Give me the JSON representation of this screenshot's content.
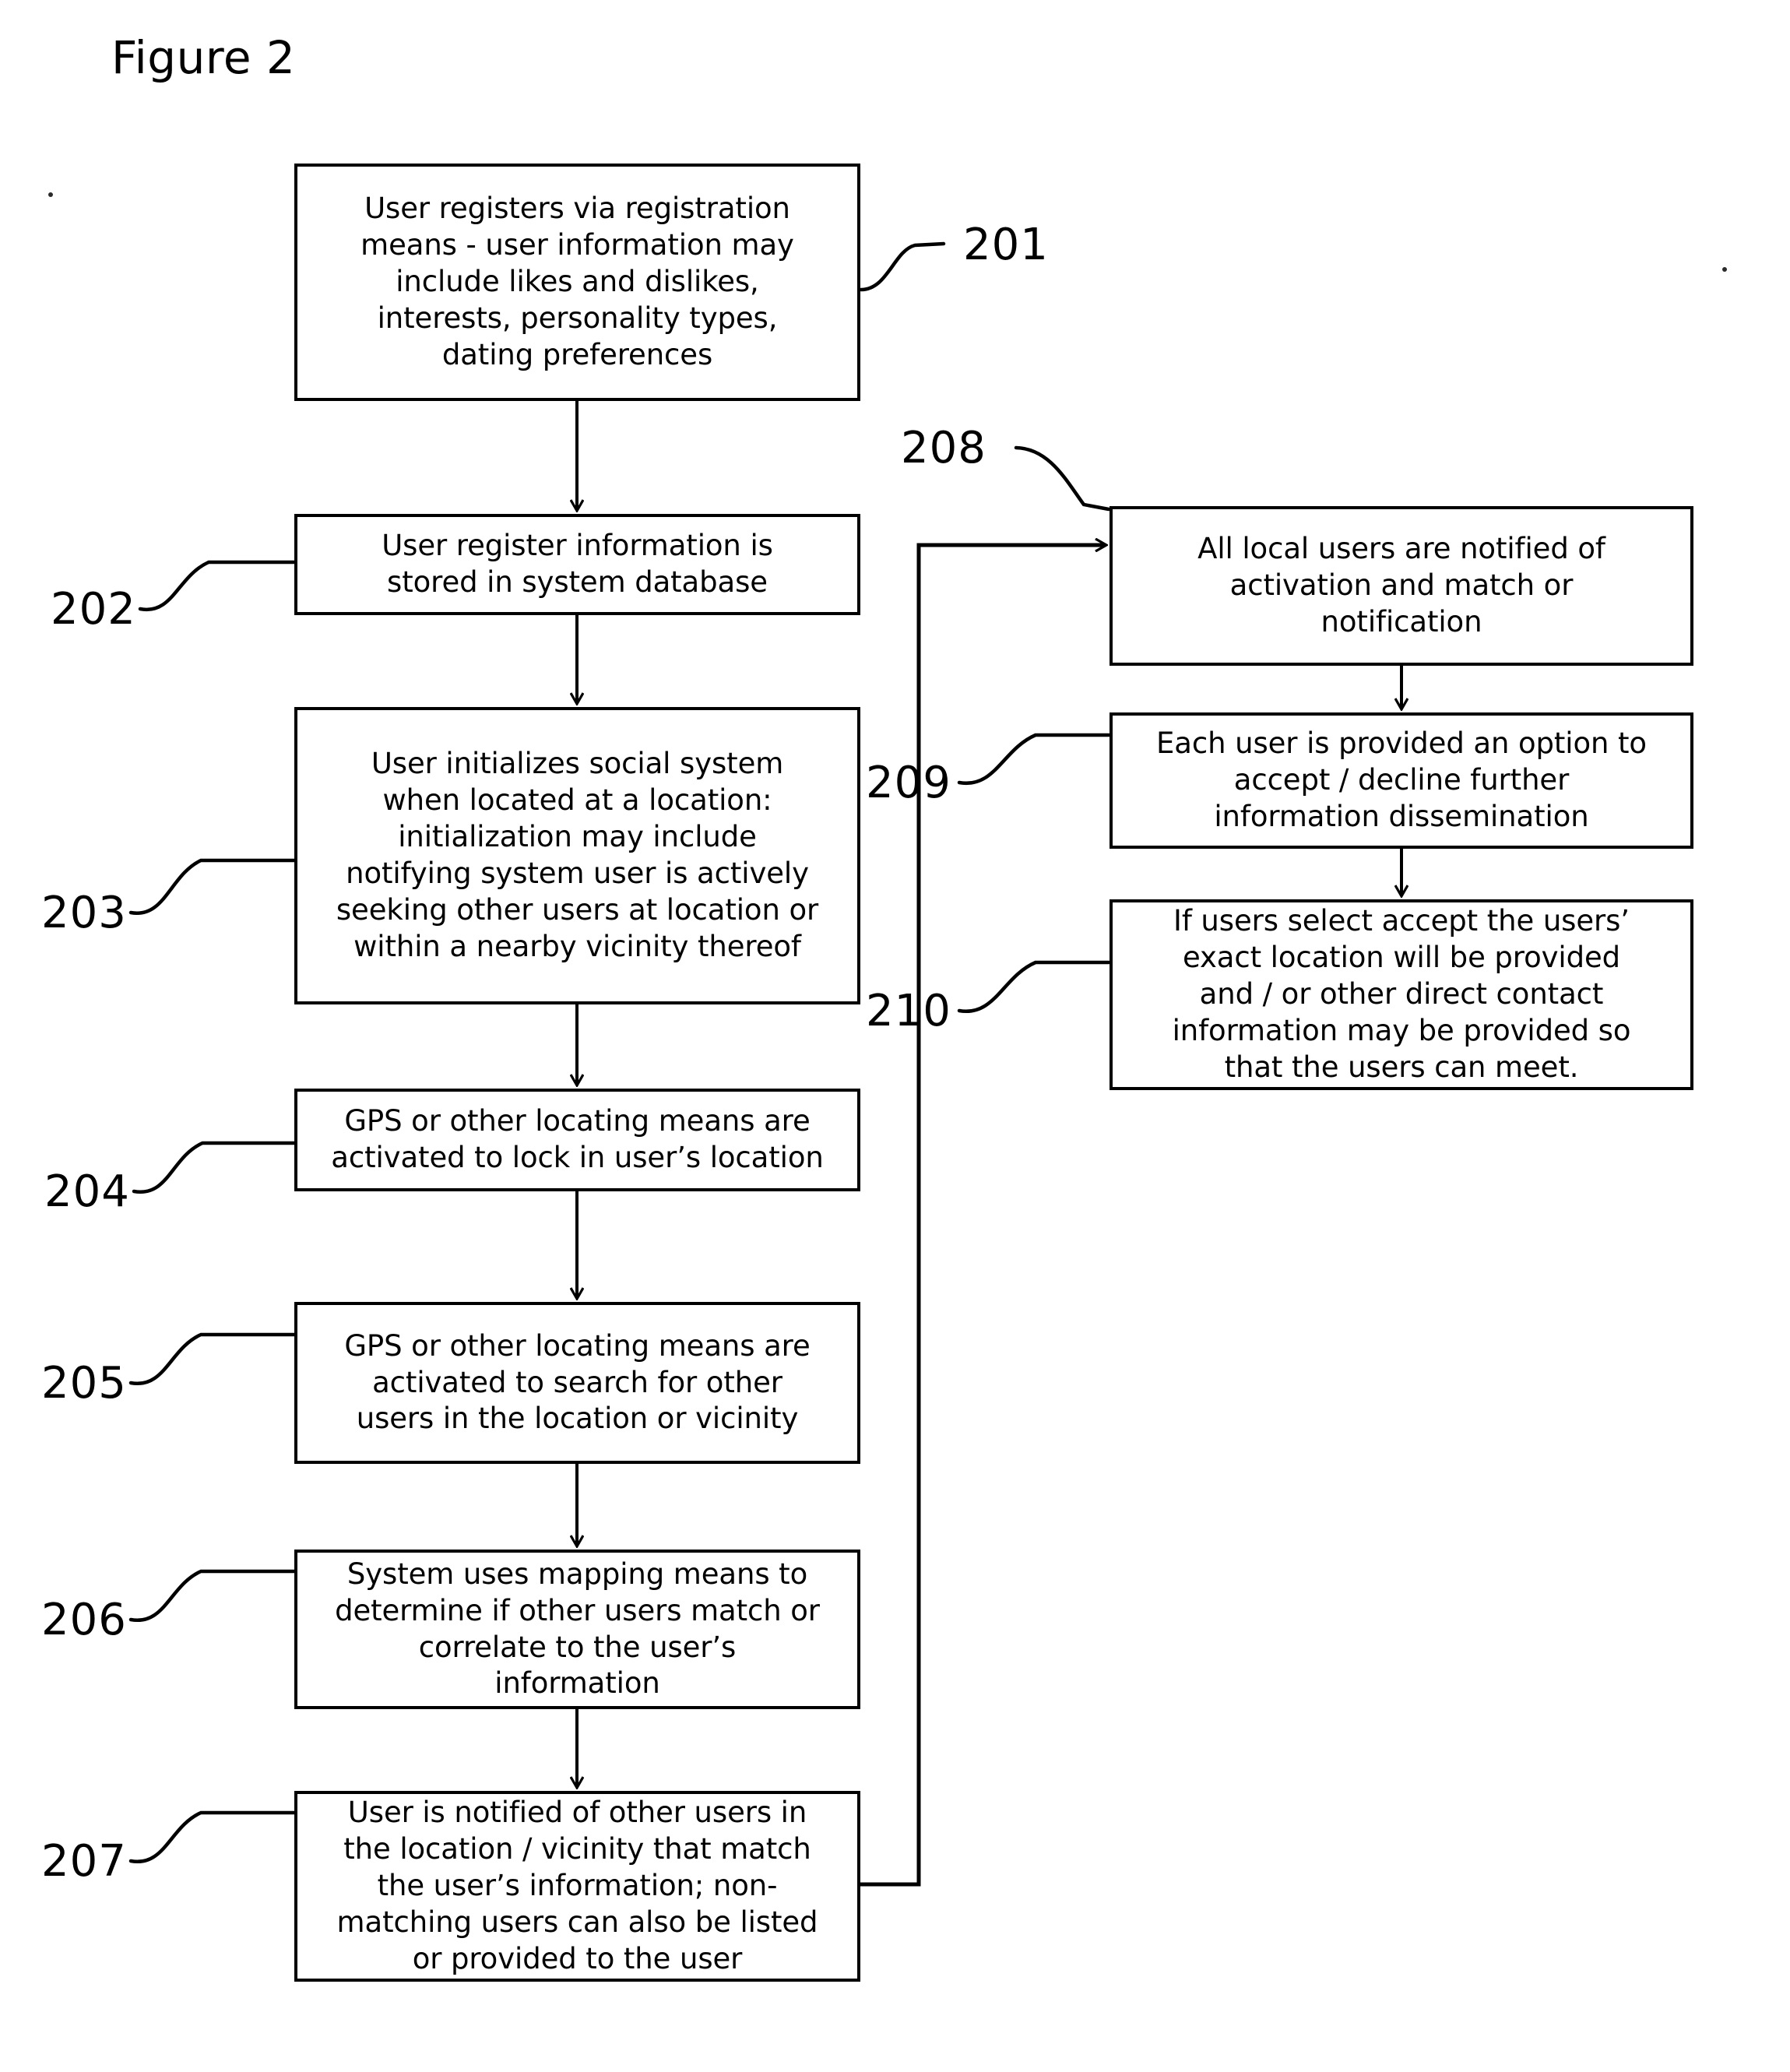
{
  "figure": {
    "title": "Figure 2"
  },
  "nodes": [
    {
      "ref": "201",
      "text": "User registers via registration\nmeans - user information may\ninclude likes and dislikes,\ninterests, personality types,\ndating preferences"
    },
    {
      "ref": "202",
      "text": "User register information is\nstored in system database"
    },
    {
      "ref": "203",
      "text": "User initializes social system\nwhen located at a location:\ninitialization may include\nnotifying system user is actively\nseeking other users at location or\nwithin a nearby vicinity thereof"
    },
    {
      "ref": "204",
      "text": "GPS or other locating means are\nactivated to lock in user’s location"
    },
    {
      "ref": "205",
      "text": "GPS or other locating means are\nactivated to search for other\nusers in the location or vicinity"
    },
    {
      "ref": "206",
      "text": "System uses mapping means to\ndetermine if other users match or\ncorrelate to the user’s\ninformation"
    },
    {
      "ref": "207",
      "text": "User is notified of other users in\nthe location / vicinity that match\nthe user’s information; non-\nmatching users can also be listed\nor provided to the user"
    },
    {
      "ref": "208",
      "text": "All local users are notified of\nactivation and match  or\nnotification"
    },
    {
      "ref": "209",
      "text": "Each user is provided an option to\naccept / decline further\ninformation dissemination"
    },
    {
      "ref": "210",
      "text": "If users select accept the users’\nexact location will be provided\nand / or other direct contact\ninformation may be provided so\nthat the users can meet."
    }
  ],
  "colors": {
    "ink": "#000000",
    "paper": "#ffffff"
  }
}
